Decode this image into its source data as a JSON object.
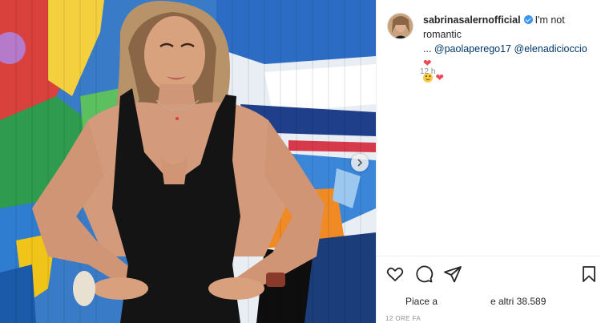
{
  "post": {
    "username": "sabrinasalernofficial",
    "caption_text": "I'm not romantic",
    "caption_ellipsis": "...",
    "mentions": [
      "@paolaperego17",
      "@elenadicioccio"
    ],
    "emoji_1": "❤",
    "emoji_2": "❤",
    "relative_time": "12 h",
    "likes_prefix": "Piace a",
    "likes_suffix": "e altri 38.589",
    "date_label": "12 ORE FA"
  },
  "icons": [
    "verified-badge-icon",
    "heart-icon",
    "comment-icon",
    "share-icon",
    "bookmark-icon",
    "chevron-right-icon",
    "smile-emoji-icon",
    "red-heart-emoji-icon"
  ],
  "colors": {
    "link": "#00376b",
    "verified": "#3897f0",
    "heart": "#ed4956",
    "muted": "#8e8e8e",
    "text": "#262626"
  }
}
